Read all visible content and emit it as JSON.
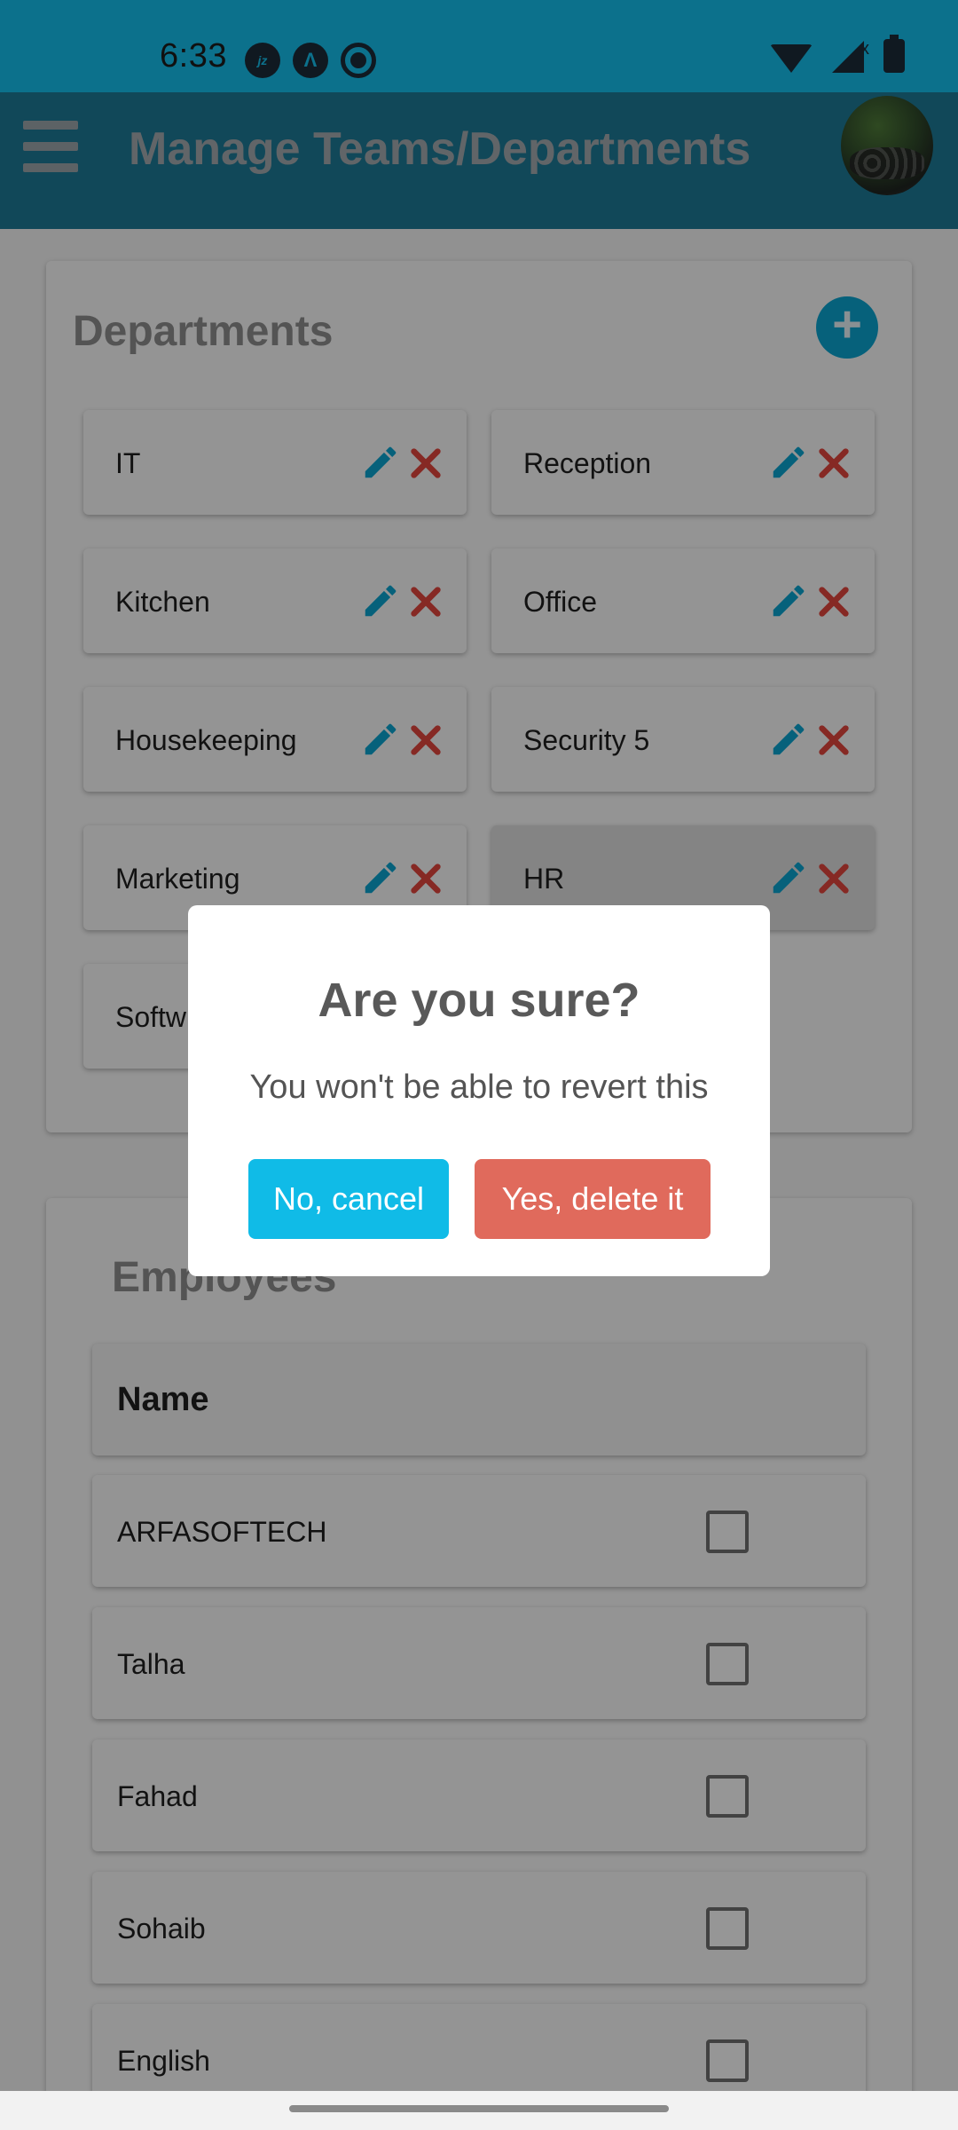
{
  "status_bar": {
    "time": "6:33",
    "left_icons": [
      "jazz-icon",
      "arc-icon",
      "record-icon"
    ],
    "right_icons": [
      "wifi-icon",
      "signal-icon",
      "battery-icon"
    ],
    "signal_badge": "x"
  },
  "app_bar": {
    "title": "Manage Teams/Departments",
    "menu_icon": "hamburger-menu-icon",
    "avatar_icon": "profile-avatar"
  },
  "departments": {
    "title": "Departments",
    "add_label": "+",
    "items": [
      {
        "label": "IT"
      },
      {
        "label": "Reception"
      },
      {
        "label": "Kitchen"
      },
      {
        "label": " Office"
      },
      {
        "label": "Housekeeping"
      },
      {
        "label": "Security 5"
      },
      {
        "label": "Marketing"
      },
      {
        "label": "HR"
      },
      {
        "label": "Softw"
      }
    ]
  },
  "employees": {
    "title": "Employees",
    "header": "Name",
    "rows": [
      {
        "name": "ARFASOFTECH",
        "checked": false
      },
      {
        "name": "Talha",
        "checked": false
      },
      {
        "name": "Fahad",
        "checked": false
      },
      {
        "name": "Sohaib",
        "checked": false
      },
      {
        "name": "English",
        "checked": false
      }
    ]
  },
  "dialog": {
    "title": "Are you sure?",
    "message": "You won't be able to revert this",
    "cancel_label": "No, cancel",
    "confirm_label": "Yes, delete it"
  },
  "colors": {
    "status_bar": "#15bdea",
    "app_bar": "#1d7894",
    "accent": "#0aa2ce",
    "cancel_button": "#10bbe7",
    "delete_button": "#e06a5c",
    "delete_icon": "#e0453c"
  }
}
